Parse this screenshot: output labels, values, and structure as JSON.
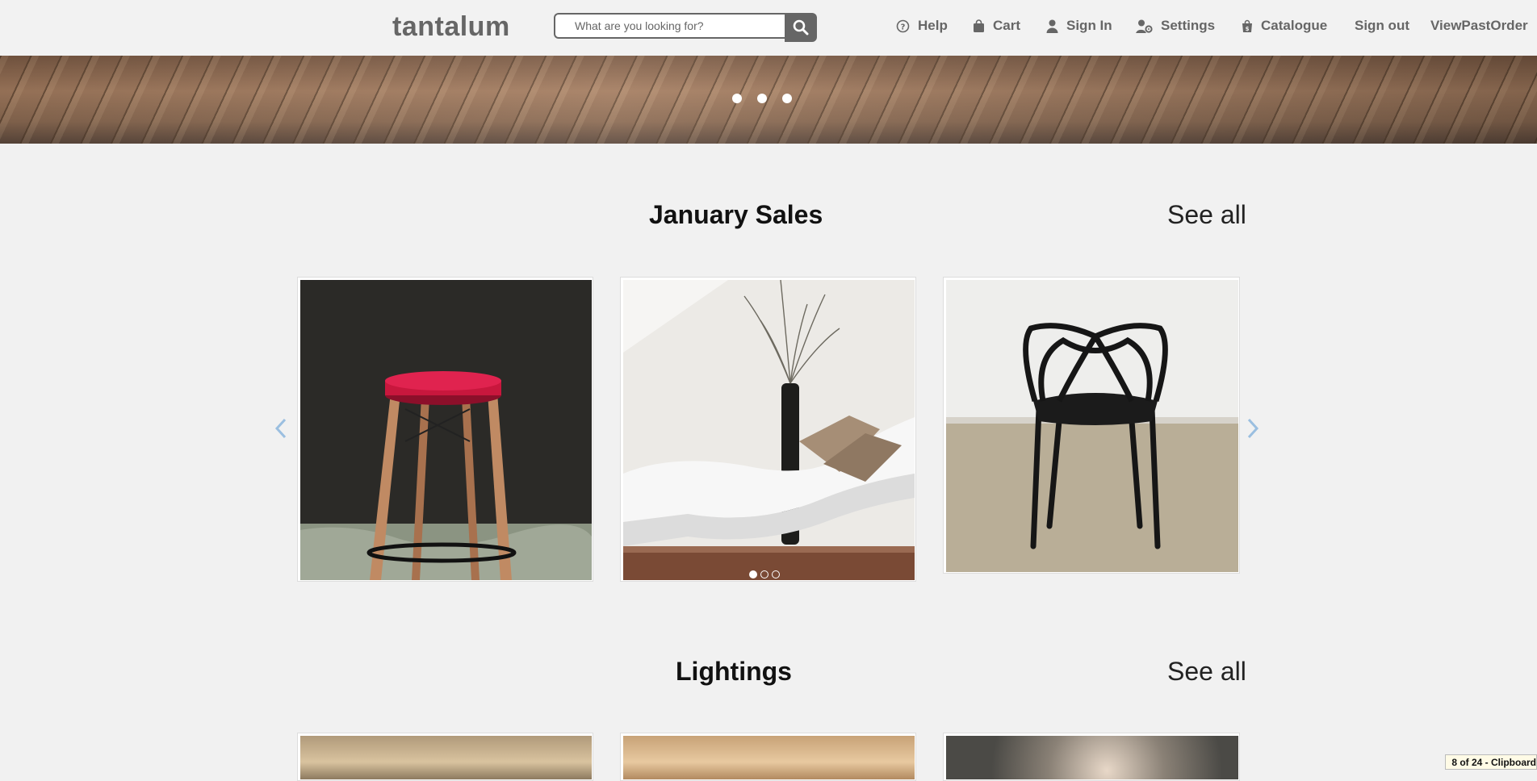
{
  "header": {
    "logo": "tantalum",
    "search": {
      "placeholder": "What are you looking for?",
      "value": ""
    },
    "nav": {
      "help": "Help",
      "cart": "Cart",
      "sign_in": "Sign In",
      "settings": "Settings",
      "catalogue": "Catalogue",
      "sign_out": "Sign out",
      "view_past_order": "ViewPastOrder"
    }
  },
  "banner": {
    "slide_count": 3
  },
  "sections": [
    {
      "title": "January Sales",
      "see_all": "See all",
      "products": [
        "red-stool",
        "white-chaise-lounge",
        "black-chair"
      ],
      "image_dots": {
        "count": 3,
        "active_index": 0
      }
    },
    {
      "title": "Lightings",
      "see_all": "See all"
    }
  ],
  "clipboard_badge": "8 of 24 - Clipboard",
  "colors": {
    "header_bg": "#f2f2f2",
    "page_bg": "#f1f1f1",
    "nav_text": "#666666",
    "arrow": "#9bbfe0"
  }
}
